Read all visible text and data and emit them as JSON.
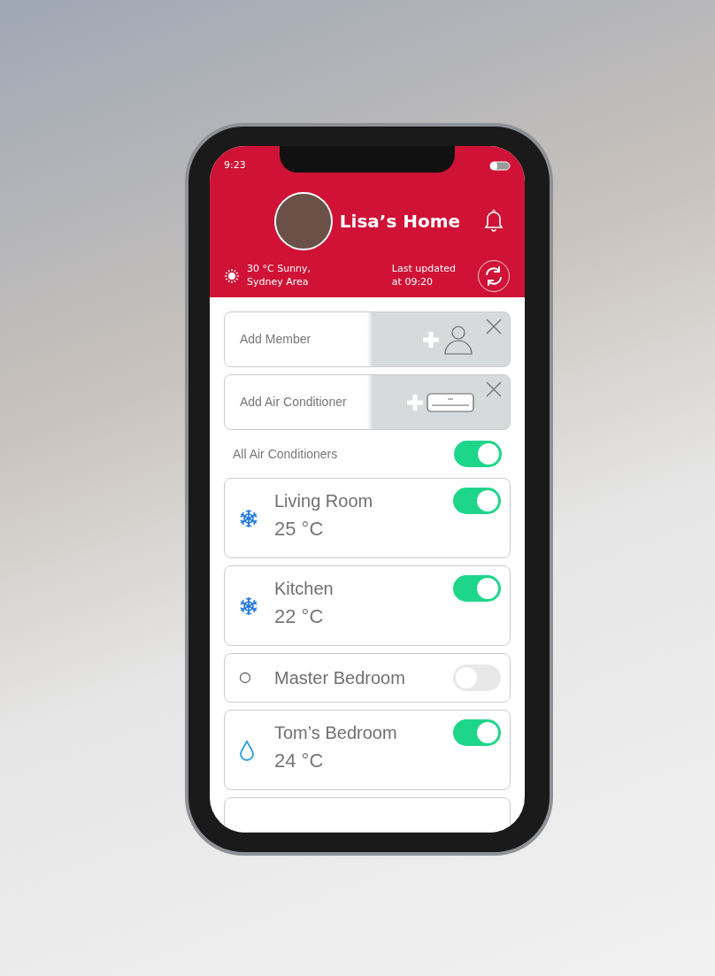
{
  "status_bar": {
    "time": "9:23"
  },
  "header": {
    "title": "Lisa’s Home",
    "weather": "30 °C Sunny,\nSydney Area",
    "last_updated": "Last updated\nat 09:20"
  },
  "add_cards": [
    {
      "kind": "member",
      "label": "Add Member"
    },
    {
      "kind": "air_conditioner",
      "label": "Add Air Conditioner"
    }
  ],
  "all_toggle": {
    "label": "All Air Conditioners",
    "on": true
  },
  "rooms": [
    {
      "name": "Living Room",
      "temperature": "25 °C",
      "kind": "cool",
      "on": true
    },
    {
      "name": "Kitchen",
      "temperature": "22 °C",
      "kind": "cool",
      "on": true
    },
    {
      "name": "Master Bedroom",
      "kind": "off",
      "on": false
    },
    {
      "name": "Tom’s Bedroom",
      "temperature": "24 °C",
      "kind": "dry",
      "on": true
    }
  ]
}
